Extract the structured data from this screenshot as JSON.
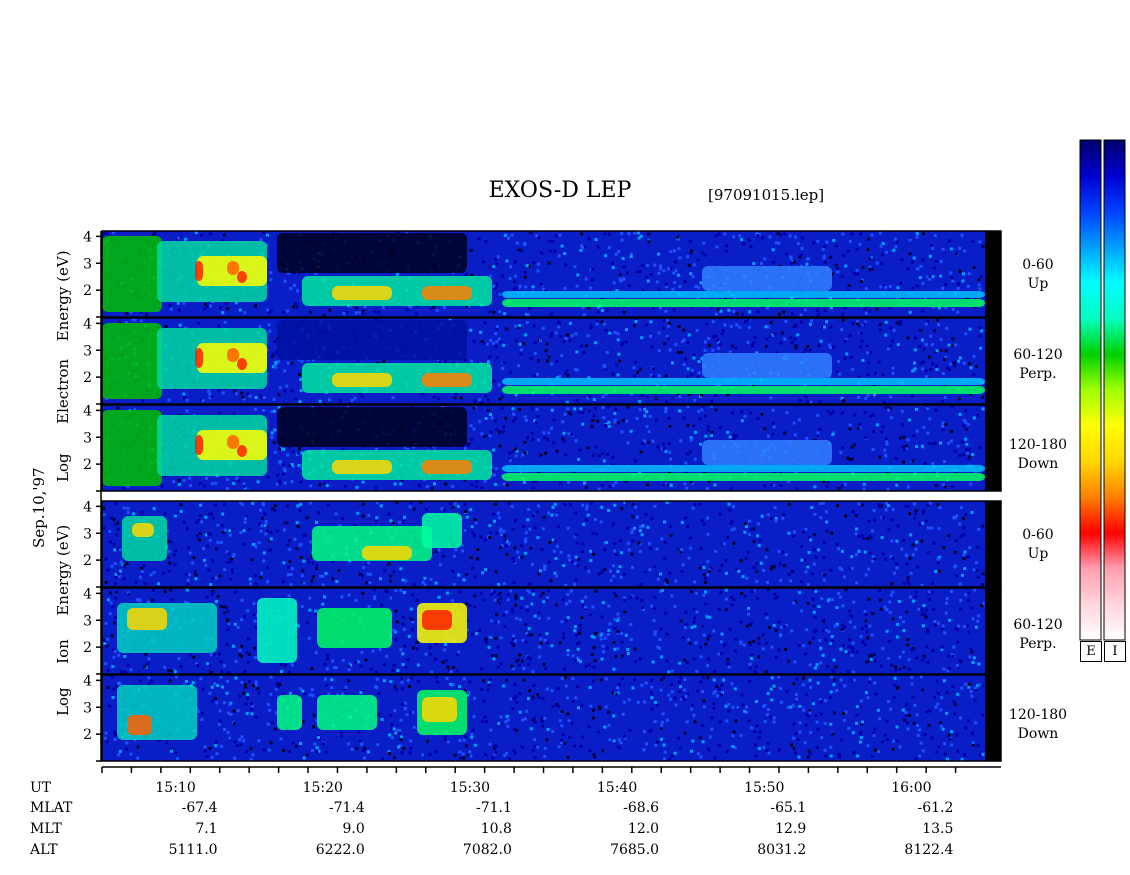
{
  "title": "EXOS-D LEP",
  "file_label": "[97091015.lep]",
  "date_label": "Sep.10,'97",
  "colors": {
    "colormap": [
      "#ffffff",
      "#ffd6dd",
      "#ff9eb0",
      "#ff0000",
      "#ff8000",
      "#ffd700",
      "#ffff00",
      "#a0ff00",
      "#00d000",
      "#00ffc0",
      "#00ffff",
      "#00a0ff",
      "#0040ff",
      "#0000d0",
      "#00006a"
    ],
    "frame": "#000000"
  },
  "chart_data": {
    "type": "heatmap",
    "x_axis": {
      "label": "UT",
      "range": [
        "15:05",
        "16:05"
      ],
      "ticks": [
        "15:10",
        "15:20",
        "15:30",
        "15:40",
        "15:50",
        "16:00"
      ]
    },
    "y_axis": {
      "ticks": [
        "2",
        "3",
        "4"
      ],
      "range": [
        1,
        4.2
      ]
    },
    "groups": [
      {
        "name": "Electron",
        "axis_label": "Log Electron Energy (eV)",
        "label_parts": [
          "Log",
          "Electron",
          "Energy (eV)"
        ],
        "panels": [
          {
            "pitch": "0-60",
            "dir": "Up"
          },
          {
            "pitch": "60-120",
            "dir": "Perp."
          },
          {
            "pitch": "120-180",
            "dir": "Down"
          }
        ]
      },
      {
        "name": "Ion",
        "axis_label": "Log Ion Energy (eV)",
        "label_parts": [
          "Log",
          "Ion",
          "Energy (eV)"
        ],
        "panels": [
          {
            "pitch": "0-60",
            "dir": "Up"
          },
          {
            "pitch": "60-120",
            "dir": "Perp."
          },
          {
            "pitch": "120-180",
            "dir": "Down"
          }
        ]
      }
    ],
    "colorbars": [
      "E",
      "I"
    ],
    "ephemeris": {
      "rows": [
        {
          "name": "UT",
          "values": [
            "15:10",
            "15:20",
            "15:30",
            "15:40",
            "15:50",
            "16:00"
          ]
        },
        {
          "name": "MLAT",
          "values": [
            "-67.4",
            "-71.4",
            "-71.1",
            "-68.6",
            "-65.1",
            "-61.2"
          ]
        },
        {
          "name": "MLT",
          "values": [
            "7.1",
            "9.0",
            "10.8",
            "12.0",
            "12.9",
            "13.5"
          ]
        },
        {
          "name": "ALT",
          "values": [
            "5111.0",
            "6222.0",
            "7082.0",
            "7685.0",
            "8031.2",
            "8122.4"
          ]
        }
      ]
    }
  }
}
